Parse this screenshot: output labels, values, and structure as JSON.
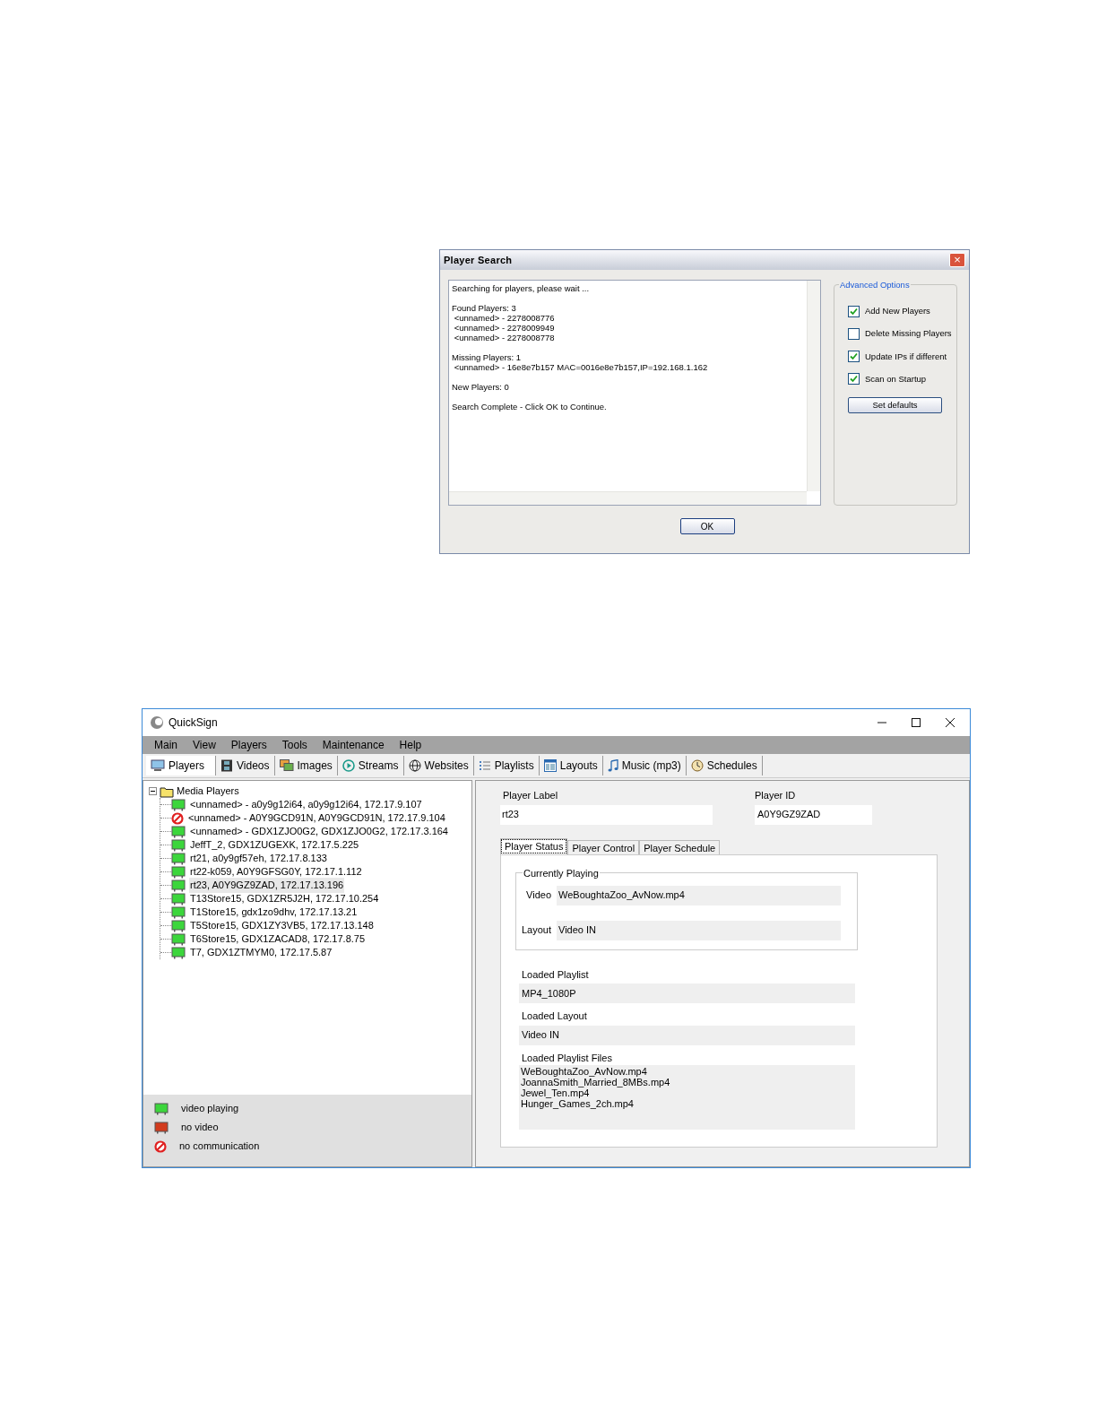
{
  "dialog": {
    "title": "Player Search",
    "close": "×",
    "log": [
      [
        "Searching for players, please wait ..."
      ],
      [
        "Found Players: 3",
        " <unnamed> - 2278008776",
        " <unnamed> - 2278009949",
        " <unnamed> - 2278008778"
      ],
      [
        "Missing Players: 1",
        " <unnamed> - 16e8e7b157 MAC=0016e8e7b157,IP=192.168.1.162"
      ],
      [
        "New Players: 0"
      ],
      [
        "Search Complete - Click OK to Continue."
      ]
    ],
    "options_title": "Advanced Options",
    "options": [
      {
        "label": "Add New Players",
        "checked": true
      },
      {
        "label": "Delete Missing Players",
        "checked": false
      },
      {
        "label": "Update IPs if different",
        "checked": true
      },
      {
        "label": "Scan on Startup",
        "checked": true
      }
    ],
    "defaults_button": "Set defaults",
    "ok_button": "OK"
  },
  "window": {
    "title": "QuickSign",
    "menu": [
      "Main",
      "View",
      "Players",
      "Tools",
      "Maintenance",
      "Help"
    ],
    "toolbar": [
      {
        "label": "Players",
        "selected": true
      },
      {
        "label": "Videos",
        "selected": false
      },
      {
        "label": "Images",
        "selected": false
      },
      {
        "label": "Streams",
        "selected": false
      },
      {
        "label": "Websites",
        "selected": false
      },
      {
        "label": "Playlists",
        "selected": false
      },
      {
        "label": "Layouts",
        "selected": false
      },
      {
        "label": "Music (mp3)",
        "selected": false
      },
      {
        "label": "Schedules",
        "selected": false
      }
    ],
    "tree": {
      "label": "Media Players",
      "expanded": true,
      "children": [
        {
          "label": "<unnamed> - a0y9g12i64, a0y9g12i64, 172.17.9.107",
          "kind": "playing",
          "selected": false
        },
        {
          "label": "<unnamed> - A0Y9GCD91N, A0Y9GCD91N, 172.17.9.104",
          "kind": "offline",
          "selected": false
        },
        {
          "label": "<unnamed> - GDX1ZJO0G2, GDX1ZJO0G2, 172.17.3.164",
          "kind": "playing",
          "selected": false
        },
        {
          "label": "JeffT_2, GDX1ZUGEXK, 172.17.5.225",
          "kind": "playing",
          "selected": false
        },
        {
          "label": "rt21, a0y9gf57eh, 172.17.8.133",
          "kind": "playing",
          "selected": false
        },
        {
          "label": "rt22-k059, A0Y9GFSG0Y, 172.17.1.112",
          "kind": "playing",
          "selected": false
        },
        {
          "label": "rt23, A0Y9GZ9ZAD, 172.17.13.196",
          "kind": "playing",
          "selected": true
        },
        {
          "label": "T13Store15, GDX1ZR5J2H, 172.17.10.254",
          "kind": "playing",
          "selected": false
        },
        {
          "label": "T1Store15, gdx1zo9dhv, 172.17.13.21",
          "kind": "playing",
          "selected": false
        },
        {
          "label": "T5Store15, GDX1ZY3VB5, 172.17.13.148",
          "kind": "playing",
          "selected": false
        },
        {
          "label": "T6Store15, GDX1ZACAD8, 172.17.8.75",
          "kind": "playing",
          "selected": false
        },
        {
          "label": "T7, GDX1ZTMYM0, 172.17.5.87",
          "kind": "playing",
          "selected": false
        }
      ]
    },
    "legend": [
      {
        "label": "video playing",
        "kind": "playing"
      },
      {
        "label": "no video",
        "kind": "stopped"
      },
      {
        "label": "no communication",
        "kind": "offline"
      }
    ],
    "player_label": {
      "label": "Player Label",
      "value": "rt23"
    },
    "player_id": {
      "label": "Player ID",
      "value": "A0Y9GZ9ZAD"
    },
    "tabs": [
      {
        "label": "Player Status",
        "selected": true
      },
      {
        "label": "Player Control",
        "selected": false
      },
      {
        "label": "Player Schedule",
        "selected": false
      }
    ],
    "currently_playing": {
      "title": "Currently Playing",
      "fields": [
        {
          "label": "Video",
          "value": "WeBoughtaZoo_AvNow.mp4"
        },
        {
          "label": "Layout",
          "value": "Video IN"
        }
      ]
    },
    "loaded": [
      {
        "label": "Loaded Playlist",
        "value": "MP4_1080P"
      },
      {
        "label": "Loaded Layout",
        "value": "Video IN"
      }
    ],
    "loaded_files": {
      "label": "Loaded Playlist Files",
      "lines": [
        "WeBoughtaZoo_AvNow.mp4",
        "JoannaSmith_Married_8MBs.mp4",
        "Jewel_Ten.mp4",
        "Hunger_Games_2ch.mp4"
      ]
    }
  }
}
